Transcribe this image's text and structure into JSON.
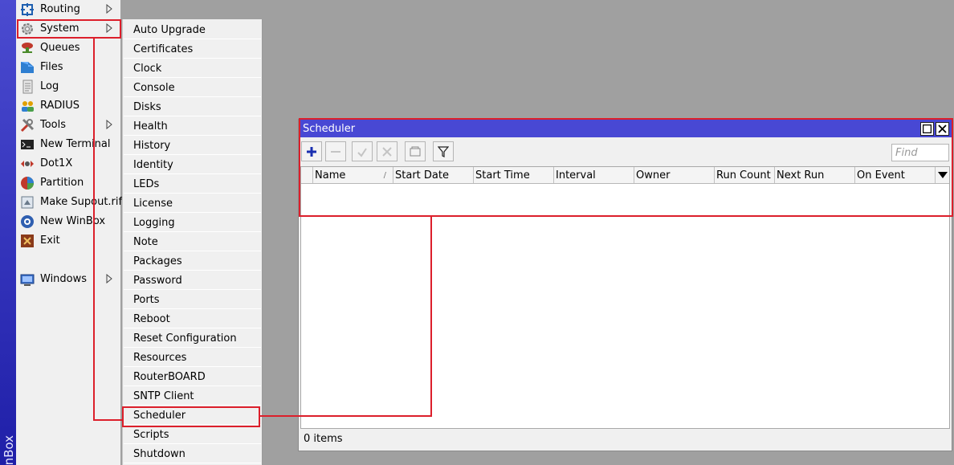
{
  "app": {
    "side_label": "nBox"
  },
  "main_menu": {
    "items": [
      {
        "label": "Routing",
        "icon": "routing-icon",
        "submenu": true
      },
      {
        "label": "System",
        "icon": "gear-icon",
        "submenu": true
      },
      {
        "label": "Queues",
        "icon": "queues-icon",
        "submenu": false
      },
      {
        "label": "Files",
        "icon": "folder-icon",
        "submenu": false
      },
      {
        "label": "Log",
        "icon": "log-icon",
        "submenu": false
      },
      {
        "label": "RADIUS",
        "icon": "users-icon",
        "submenu": false
      },
      {
        "label": "Tools",
        "icon": "tools-icon",
        "submenu": true
      },
      {
        "label": "New Terminal",
        "icon": "terminal-icon",
        "submenu": false
      },
      {
        "label": "Dot1X",
        "icon": "dot1x-icon",
        "submenu": false
      },
      {
        "label": "Partition",
        "icon": "partition-icon",
        "submenu": false
      },
      {
        "label": "Make Supout.rif",
        "icon": "supout-icon",
        "submenu": false
      },
      {
        "label": "New WinBox",
        "icon": "winbox-icon",
        "submenu": false
      },
      {
        "label": "Exit",
        "icon": "exit-icon",
        "submenu": false
      },
      {
        "label": "Windows",
        "icon": "windows-icon",
        "submenu": true
      }
    ]
  },
  "system_submenu": {
    "items": [
      "Auto Upgrade",
      "Certificates",
      "Clock",
      "Console",
      "Disks",
      "Health",
      "History",
      "Identity",
      "LEDs",
      "License",
      "Logging",
      "Note",
      "Packages",
      "Password",
      "Ports",
      "Reboot",
      "Reset Configuration",
      "Resources",
      "RouterBOARD",
      "SNTP Client",
      "Scheduler",
      "Scripts",
      "Shutdown"
    ]
  },
  "scheduler_window": {
    "title": "Scheduler",
    "find_placeholder": "Find",
    "columns": [
      "Name",
      "Start Date",
      "Start Time",
      "Interval",
      "Owner",
      "Run Count",
      "Next Run",
      "On Event"
    ],
    "sort_indicator": "/",
    "status": "0 items"
  },
  "colors": {
    "title_bar": "#4848d4",
    "annotation": "#dc1f2b",
    "add_icon": "#1a2fb0",
    "desktop": "#a0a0a0"
  }
}
